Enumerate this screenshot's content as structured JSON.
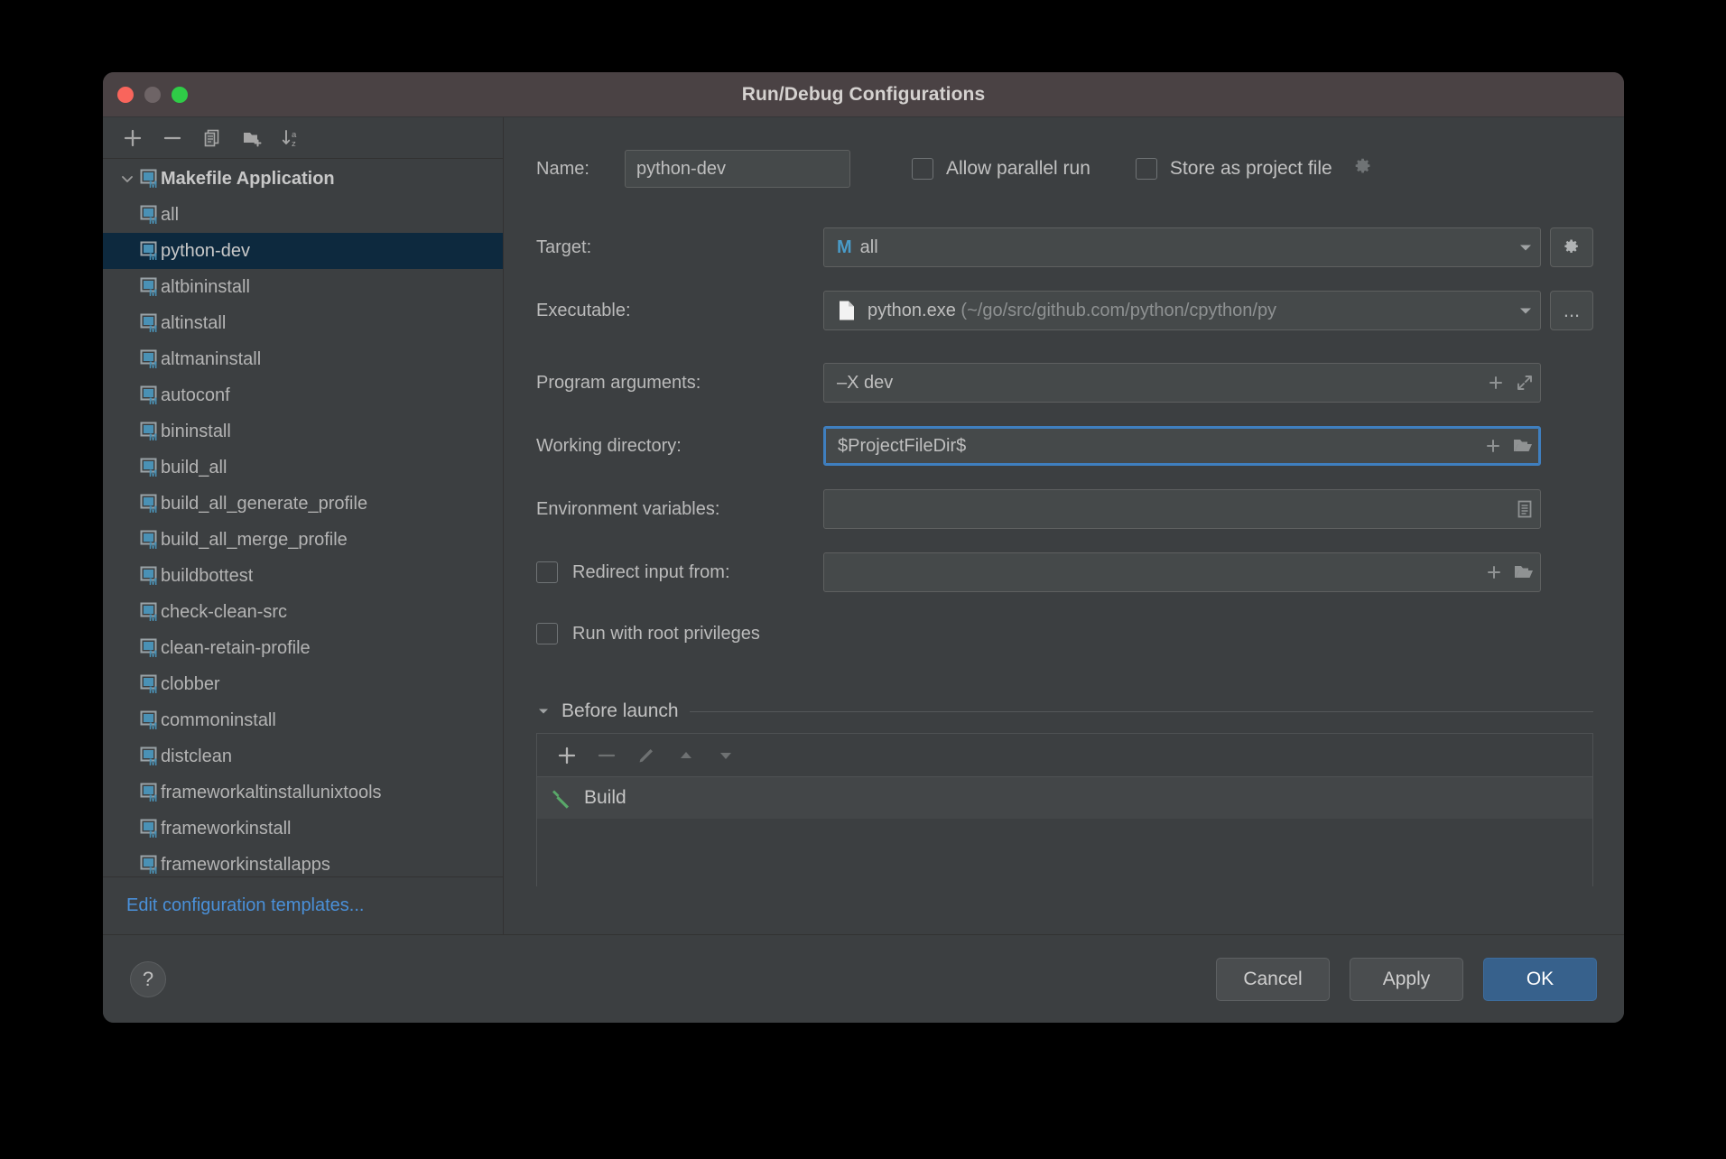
{
  "window": {
    "title": "Run/Debug Configurations",
    "traffic_lights": [
      "close-button",
      "minimize-button",
      "zoom-button"
    ]
  },
  "sidebar": {
    "toolbar": [
      {
        "name": "add-configuration-button",
        "icon": "plus-icon"
      },
      {
        "name": "remove-configuration-button",
        "icon": "minus-icon"
      },
      {
        "name": "copy-configuration-button",
        "icon": "copy-icon"
      },
      {
        "name": "new-folder-button",
        "icon": "folder-add-icon"
      },
      {
        "name": "sort-configurations-button",
        "icon": "sort-az-icon"
      }
    ],
    "group": {
      "label": "Makefile Application",
      "expanded": true
    },
    "items": [
      {
        "label": "all",
        "selected": false
      },
      {
        "label": "python-dev",
        "selected": true
      },
      {
        "label": "altbininstall",
        "selected": false
      },
      {
        "label": "altinstall",
        "selected": false
      },
      {
        "label": "altmaninstall",
        "selected": false
      },
      {
        "label": "autoconf",
        "selected": false
      },
      {
        "label": "bininstall",
        "selected": false
      },
      {
        "label": "build_all",
        "selected": false
      },
      {
        "label": "build_all_generate_profile",
        "selected": false
      },
      {
        "label": "build_all_merge_profile",
        "selected": false
      },
      {
        "label": "buildbottest",
        "selected": false
      },
      {
        "label": "check-clean-src",
        "selected": false
      },
      {
        "label": "clean-retain-profile",
        "selected": false
      },
      {
        "label": "clobber",
        "selected": false
      },
      {
        "label": "commoninstall",
        "selected": false
      },
      {
        "label": "distclean",
        "selected": false
      },
      {
        "label": "frameworkaltinstallunixtools",
        "selected": false
      },
      {
        "label": "frameworkinstall",
        "selected": false
      },
      {
        "label": "frameworkinstallapps",
        "selected": false
      }
    ],
    "edit_templates_link": "Edit configuration templates..."
  },
  "form": {
    "name_label": "Name:",
    "name_value": "python-dev",
    "allow_parallel_run": {
      "label": "Allow parallel run",
      "checked": false
    },
    "store_as_project_file": {
      "label": "Store as project file",
      "checked": false
    },
    "target": {
      "label": "Target:",
      "badge": "M",
      "value": "all"
    },
    "executable": {
      "label": "Executable:",
      "value": "python.exe",
      "path_hint": "(~/go/src/github.com/python/cpython/py",
      "browse_label": "..."
    },
    "program_arguments": {
      "label": "Program arguments:",
      "value": "–X  dev"
    },
    "working_directory": {
      "label": "Working directory:",
      "value": "$ProjectFileDir$",
      "focused": true
    },
    "environment_variables": {
      "label": "Environment variables:",
      "value": ""
    },
    "redirect_input": {
      "label": "Redirect input from:",
      "checked": false,
      "value": ""
    },
    "run_with_root": {
      "label": "Run with root privileges",
      "checked": false
    }
  },
  "before_launch": {
    "title": "Before launch",
    "expanded": true,
    "toolbar": [
      {
        "name": "add-task-button",
        "icon": "plus-icon",
        "enabled": true
      },
      {
        "name": "remove-task-button",
        "icon": "minus-icon",
        "enabled": false
      },
      {
        "name": "edit-task-button",
        "icon": "pencil-icon",
        "enabled": false
      },
      {
        "name": "move-task-up-button",
        "icon": "arrow-up-icon",
        "enabled": false
      },
      {
        "name": "move-task-down-button",
        "icon": "arrow-down-icon",
        "enabled": false
      }
    ],
    "tasks": [
      {
        "label": "Build",
        "icon": "hammer-icon"
      }
    ]
  },
  "footer": {
    "help_label": "?",
    "cancel_label": "Cancel",
    "apply_label": "Apply",
    "ok_label": "OK"
  },
  "colors": {
    "window_bg": "#3c3f41",
    "titlebar_bg": "#4a4244",
    "selection_bg": "#0d293e",
    "accent_blue": "#4a90d9",
    "primary_button": "#37618c",
    "makefile_icon": "#4a91b5",
    "build_icon_green": "#59a869"
  }
}
